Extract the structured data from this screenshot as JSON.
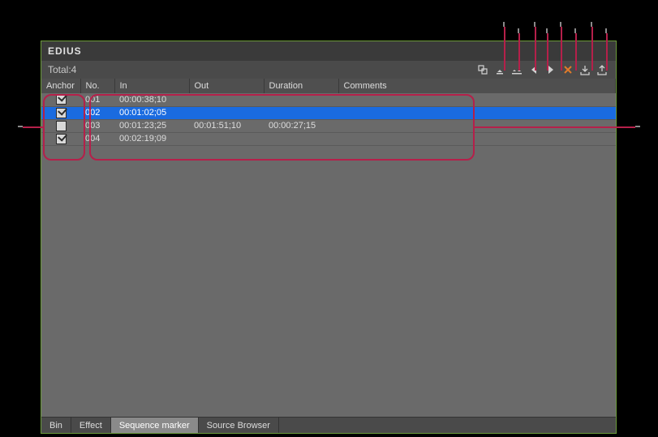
{
  "app": {
    "title": "EDIUS"
  },
  "header": {
    "total_label": "Total:4"
  },
  "toolbar": {
    "icons": [
      "toggle-marker-icon",
      "set-marker-icon",
      "set-inout-marker-icon",
      "prev-icon",
      "next-icon",
      "delete-icon",
      "import-icon",
      "export-icon"
    ]
  },
  "columns": {
    "anchor": "Anchor",
    "no": "No.",
    "in": "In",
    "out": "Out",
    "duration": "Duration",
    "comments": "Comments"
  },
  "rows": [
    {
      "anchor": true,
      "no": "001",
      "in": "00:00:38;10",
      "out": "",
      "duration": "",
      "comments": "",
      "selected": false
    },
    {
      "anchor": true,
      "no": "002",
      "in": "00:01:02;05",
      "out": "",
      "duration": "",
      "comments": "",
      "selected": true
    },
    {
      "anchor": false,
      "no": "003",
      "in": "00:01:23;25",
      "out": "00:01:51;10",
      "duration": "00:00:27;15",
      "comments": "",
      "selected": false
    },
    {
      "anchor": true,
      "no": "004",
      "in": "00:02:19;09",
      "out": "",
      "duration": "",
      "comments": "",
      "selected": false
    }
  ],
  "tabs": {
    "items": [
      {
        "label": "Bin",
        "active": false
      },
      {
        "label": "Effect",
        "active": false
      },
      {
        "label": "Sequence marker",
        "active": true
      },
      {
        "label": "Source Browser",
        "active": false
      }
    ]
  }
}
